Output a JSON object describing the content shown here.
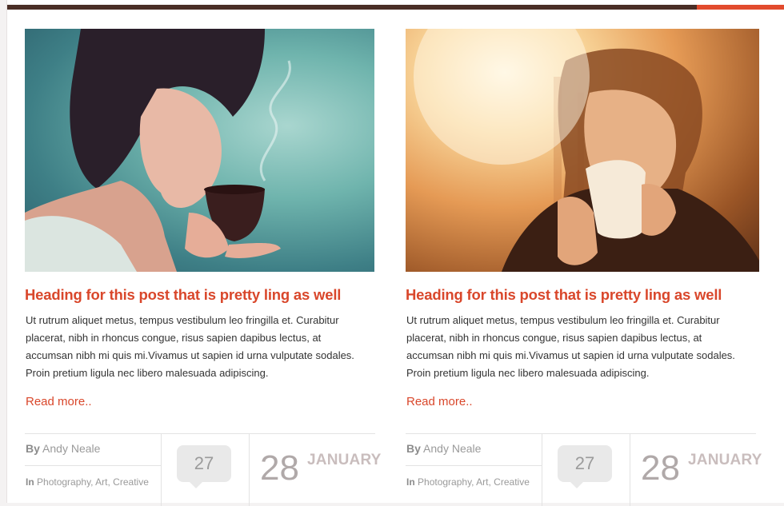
{
  "posts": [
    {
      "heading": "Heading for this post that is pretty ling as well",
      "excerpt": "Ut rutrum aliquet metus, tempus vestibulum leo fringilla et. Curabitur placerat, nibh in rhoncus congue, risus sapien dapibus lectus, at accumsan nibh mi quis mi.Vivamus ut sapien id urna vulputate sodales. Proin pretium ligula nec libero malesuada adipiscing.",
      "read_more": "Read more..",
      "by_label": "By",
      "author": "Andy Neale",
      "in_label": "In",
      "categories": "Photography, Art, Creative",
      "comments": "27",
      "day": "28",
      "month": "JANUARY"
    },
    {
      "heading": "Heading for this post that is pretty ling as well",
      "excerpt": "Ut rutrum aliquet metus, tempus vestibulum leo fringilla et. Curabitur placerat, nibh in rhoncus congue, risus sapien dapibus lectus, at accumsan nibh mi quis mi.Vivamus ut sapien id urna vulputate sodales. Proin pretium ligula nec libero malesuada adipiscing.",
      "read_more": "Read more..",
      "by_label": "By",
      "author": "Andy Neale",
      "in_label": "In",
      "categories": "Photography, Art, Creative",
      "comments": "27",
      "day": "28",
      "month": "JANUARY"
    }
  ],
  "colors": {
    "accent": "#d9472b",
    "topbar": "#4a2e26",
    "topbar_accent": "#e24b2d"
  }
}
